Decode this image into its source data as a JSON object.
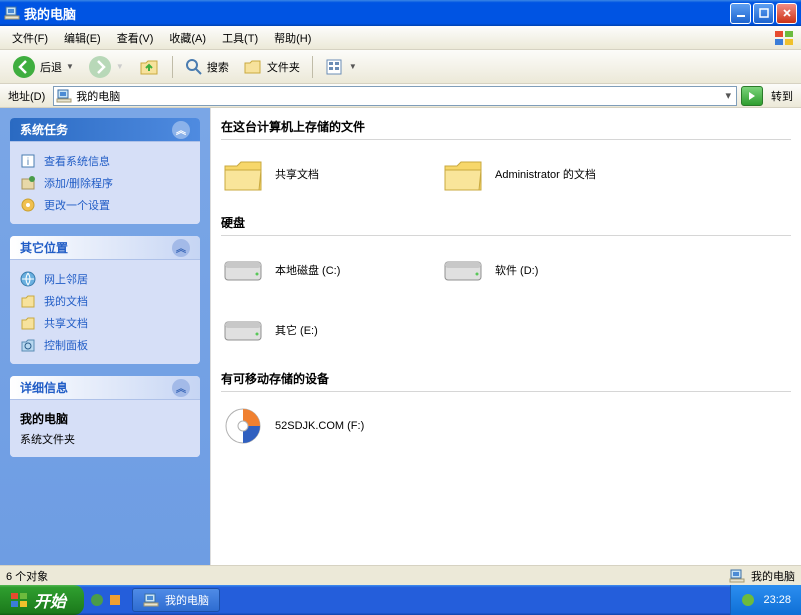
{
  "window": {
    "title": "我的电脑"
  },
  "menu": {
    "file": "文件(F)",
    "edit": "编辑(E)",
    "view": "查看(V)",
    "favorites": "收藏(A)",
    "tools": "工具(T)",
    "help": "帮助(H)"
  },
  "toolbar": {
    "back": "后退",
    "search": "搜索",
    "folders": "文件夹"
  },
  "addressbar": {
    "label": "地址(D)",
    "value": "我的电脑",
    "go": "转到"
  },
  "sidebar": {
    "tasks": {
      "title": "系统任务",
      "items": [
        "查看系统信息",
        "添加/删除程序",
        "更改一个设置"
      ]
    },
    "places": {
      "title": "其它位置",
      "items": [
        "网上邻居",
        "我的文档",
        "共享文档",
        "控制面板"
      ]
    },
    "details": {
      "title": "详细信息",
      "name": "我的电脑",
      "type": "系统文件夹"
    }
  },
  "main": {
    "section_files": "在这台计算机上存储的文件",
    "section_disks": "硬盘",
    "section_removable": "有可移动存储的设备",
    "files": [
      {
        "label": "共享文档"
      },
      {
        "label": "Administrator 的文档"
      }
    ],
    "disks": [
      {
        "label": "本地磁盘 (C:)"
      },
      {
        "label": "软件 (D:)"
      },
      {
        "label": "其它 (E:)"
      }
    ],
    "removable": [
      {
        "label": "52SDJK.COM (F:)"
      }
    ]
  },
  "statusbar": {
    "objects": "6 个对象",
    "location": "我的电脑"
  },
  "taskbar": {
    "start": "开始",
    "task": "我的电脑",
    "time": "23:28"
  }
}
